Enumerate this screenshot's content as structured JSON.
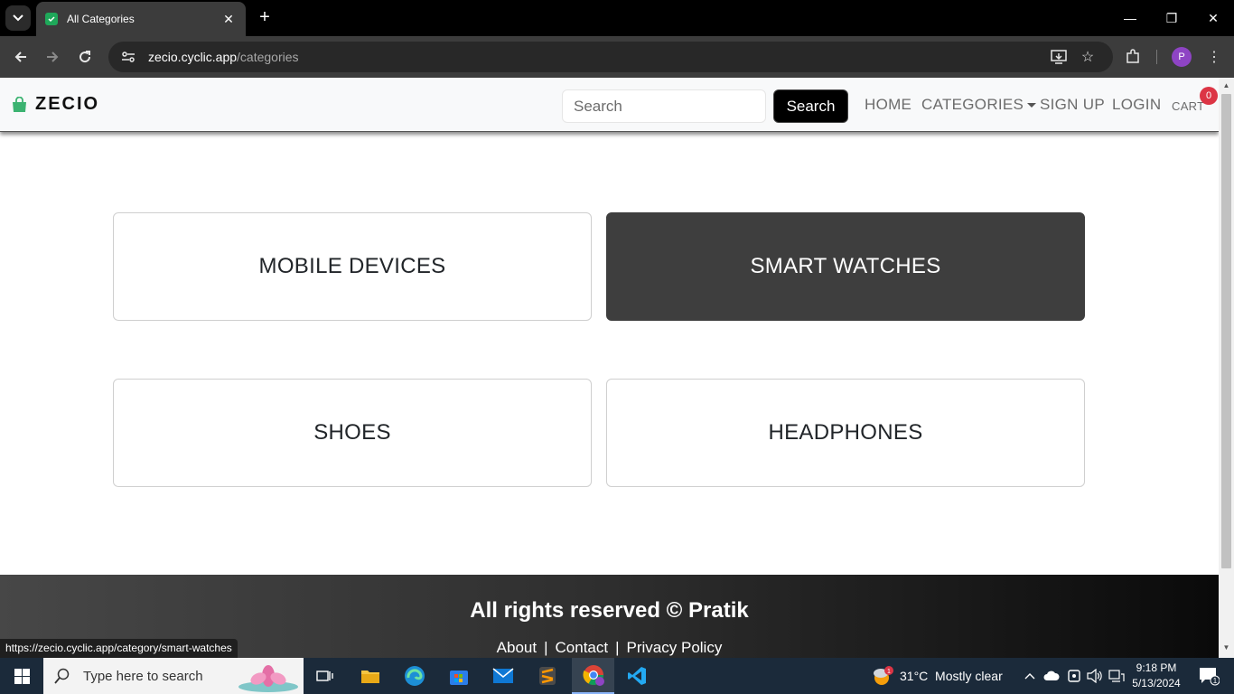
{
  "browser": {
    "tab_title": "All Categories",
    "url_host": "zecio.cyclic.app",
    "url_path": "/categories",
    "profile_initial": "P",
    "status_url": "https://zecio.cyclic.app/category/smart-watches"
  },
  "navbar": {
    "brand": "ZECIO",
    "search_placeholder": "Search",
    "search_button": "Search",
    "links": {
      "home": "HOME",
      "categories": "CATEGORIES",
      "signup": "SIGN UP",
      "login": "LOGIN",
      "cart": "CART"
    },
    "cart_count": "0"
  },
  "categories": [
    {
      "label": "MOBILE DEVICES",
      "active": false
    },
    {
      "label": "SMART WATCHES",
      "active": true
    },
    {
      "label": "SHOES",
      "active": false
    },
    {
      "label": "HEADPHONES",
      "active": false
    }
  ],
  "footer": {
    "title": "All rights reserved © Pratik",
    "links": [
      "About",
      "Contact",
      "Privacy Policy"
    ],
    "separator": "|"
  },
  "taskbar": {
    "search_placeholder": "Type here to search",
    "weather": "31°C  Mostly clear",
    "weather_badge": "1",
    "time": "9:18 PM",
    "date": "5/13/2024",
    "notification_count": "1"
  },
  "colors": {
    "active_card": "#3e3e3e",
    "cart_badge": "#dc3545",
    "brand_icon": "#3cb371"
  }
}
